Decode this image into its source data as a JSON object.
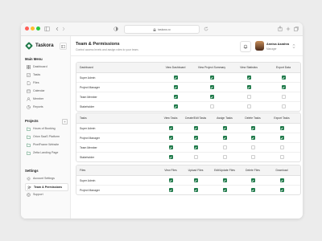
{
  "browser": {
    "url": "taskora.co"
  },
  "brand": {
    "name": "Taskora",
    "color": "#1f7a4a"
  },
  "sidebar": {
    "main_menu_title": "Main Menu",
    "main_menu": [
      {
        "label": "Dashboard",
        "icon": "dashboard-icon"
      },
      {
        "label": "Tasks",
        "icon": "tasks-icon"
      },
      {
        "label": "Files",
        "icon": "files-icon"
      },
      {
        "label": "Calendar",
        "icon": "calendar-icon"
      },
      {
        "label": "Member",
        "icon": "member-icon"
      },
      {
        "label": "Reports",
        "icon": "reports-icon"
      }
    ],
    "projects_title": "Projects",
    "projects": [
      {
        "label": "Hours of Booking"
      },
      {
        "label": "Orion SaaS Platform"
      },
      {
        "label": "PixelFrame Website"
      },
      {
        "label": "Zetta Landing Page"
      }
    ],
    "settings_title": "Settings",
    "settings": [
      {
        "label": "Account Settings"
      },
      {
        "label": "Team & Permissions",
        "active": true
      },
      {
        "label": "Support"
      }
    ]
  },
  "header": {
    "title": "Team & Permissions",
    "subtitle": "Control access levels and assign roles to your team.",
    "user_name": "Annisa Azzahra",
    "user_role": "Manager"
  },
  "tables": [
    {
      "section": "Dashboard",
      "columns": [
        "View Dashboard",
        "View Project Summary",
        "View Statistics",
        "Export Data"
      ],
      "rows": [
        {
          "role": "Super Admin",
          "checks": [
            true,
            true,
            true,
            true
          ]
        },
        {
          "role": "Project Manager",
          "checks": [
            true,
            true,
            true,
            true
          ]
        },
        {
          "role": "Team Member",
          "checks": [
            true,
            true,
            false,
            false
          ]
        },
        {
          "role": "Stakeholder",
          "checks": [
            true,
            false,
            false,
            false
          ]
        }
      ]
    },
    {
      "section": "Tasks",
      "columns": [
        "View Tasks",
        "Create/Edit Tasks",
        "Assign Tasks",
        "Delete Tasks",
        "Export Tasks"
      ],
      "rows": [
        {
          "role": "Super Admin",
          "checks": [
            true,
            true,
            true,
            true,
            true
          ]
        },
        {
          "role": "Project Manager",
          "checks": [
            true,
            true,
            true,
            true,
            true
          ]
        },
        {
          "role": "Team Member",
          "checks": [
            true,
            true,
            false,
            false,
            false
          ]
        },
        {
          "role": "Stakeholder",
          "checks": [
            true,
            false,
            false,
            false,
            false
          ]
        }
      ]
    },
    {
      "section": "Files",
      "columns": [
        "View Files",
        "Upload Files",
        "Edit/Update Files",
        "Delete Files",
        "Download"
      ],
      "rows": [
        {
          "role": "Super Admin",
          "checks": [
            true,
            true,
            true,
            true,
            true
          ]
        },
        {
          "role": "Project Manager",
          "checks": [
            true,
            true,
            true,
            true,
            true
          ]
        }
      ]
    }
  ]
}
